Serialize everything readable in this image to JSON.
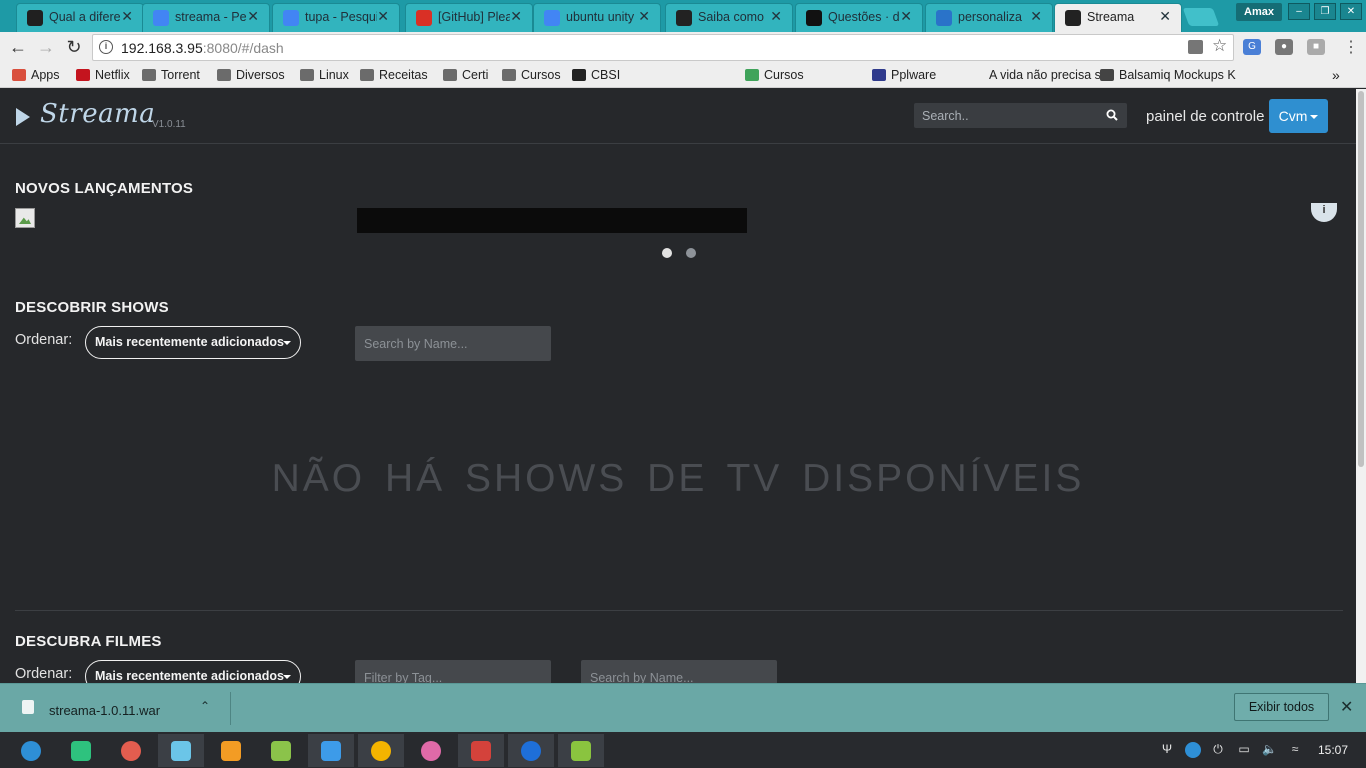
{
  "browser": {
    "tabs": [
      {
        "title": "Qual a diferença",
        "icon": "tux-icon",
        "color": "#202020"
      },
      {
        "title": "streama - Pesquisa",
        "icon": "google-icon",
        "color": "#4285f4"
      },
      {
        "title": "tupa - Pesquisa",
        "icon": "google-icon",
        "color": "#4285f4"
      },
      {
        "title": "[GitHub] Please",
        "icon": "gmail-icon",
        "color": "#d93025"
      },
      {
        "title": "ubuntu unity",
        "icon": "google-icon",
        "color": "#4285f4"
      },
      {
        "title": "Saiba como",
        "icon": "ld-icon",
        "color": "#222222"
      },
      {
        "title": "Questões · d",
        "icon": "github-icon",
        "color": "#111111"
      },
      {
        "title": "personaliza",
        "icon": "d-icon",
        "color": "#2a73c9"
      },
      {
        "title": "Streama",
        "icon": "play-icon",
        "color": "#222222"
      }
    ],
    "profile_name": "Amax",
    "url_host": "192.168.3.95",
    "url_rest": ":8080/#/dash"
  },
  "bookmarks": [
    {
      "label": "Apps",
      "icon": "apps-icon",
      "color": "#d94f3d"
    },
    {
      "label": "Netflix",
      "icon": "netflix-icon",
      "color": "#c4141e"
    },
    {
      "label": "Torrent",
      "icon": "folder-icon",
      "color": "#6b6b6b"
    },
    {
      "label": "Diversos",
      "icon": "folder-icon",
      "color": "#6b6b6b"
    },
    {
      "label": "Linux",
      "icon": "folder-icon",
      "color": "#6b6b6b"
    },
    {
      "label": "Receitas",
      "icon": "folder-icon",
      "color": "#6b6b6b"
    },
    {
      "label": "Certi",
      "icon": "folder-icon",
      "color": "#6b6b6b"
    },
    {
      "label": "Cursos",
      "icon": "folder-icon",
      "color": "#6b6b6b"
    },
    {
      "label": "CBSI",
      "icon": "cbsi-icon",
      "color": "#222222"
    },
    {
      "label": "Cursos",
      "icon": "cursos-icon",
      "color": "#3fa35a"
    },
    {
      "label": "Pplware",
      "icon": "pplware-icon",
      "color": "#2f3a8c"
    },
    {
      "label": "A vida não precisa se",
      "icon": "blank-icon",
      "color": "#eeeeee"
    },
    {
      "label": "Balsamiq Mockups K",
      "icon": "balsamiq-icon",
      "color": "#444444"
    }
  ],
  "app": {
    "logo": "Streama",
    "version": "V1.0.11",
    "search_placeholder": "Search..",
    "dashboard_link": "painel de controle",
    "user_button": "Cvm",
    "new_releases_title": "NOVOS LANÇAMENTOS",
    "discover_shows_title": "DESCOBRIR SHOWS",
    "order_label": "Ordenar:",
    "order_value": "Mais recentemente adicionados",
    "search_by_name": "Search by Name...",
    "no_shows": "NÃO HÁ SHOWS DE TV DISPONÍVEIS",
    "discover_movies_title": "DESCUBRA FILMES",
    "filter_by_tag": "Filter by Tag...",
    "info_badge": "i"
  },
  "downloads": {
    "file_name": "streama-1.0.11.war",
    "show_all": "Exibir todos"
  },
  "taskbar": {
    "clock": "15:07",
    "apps": [
      {
        "name": "launcher-icon",
        "color": "#2e8fd6"
      },
      {
        "name": "terminal-icon",
        "color": "#2ec27e"
      },
      {
        "name": "screenshot-icon",
        "color": "#e35d4f"
      },
      {
        "name": "store-icon",
        "color": "#6bc5e8"
      },
      {
        "name": "archive-icon",
        "color": "#f39c24"
      },
      {
        "name": "music-icon",
        "color": "#8bc34a"
      },
      {
        "name": "video-icon",
        "color": "#3d9be9"
      },
      {
        "name": "chrome-icon",
        "color": "#f4b400"
      },
      {
        "name": "settings-icon",
        "color": "#e06aa8"
      },
      {
        "name": "console-icon",
        "color": "#d4423b"
      },
      {
        "name": "teamviewer-icon",
        "color": "#1e6fd9"
      },
      {
        "name": "monitor-icon",
        "color": "#8ac43f"
      }
    ]
  }
}
